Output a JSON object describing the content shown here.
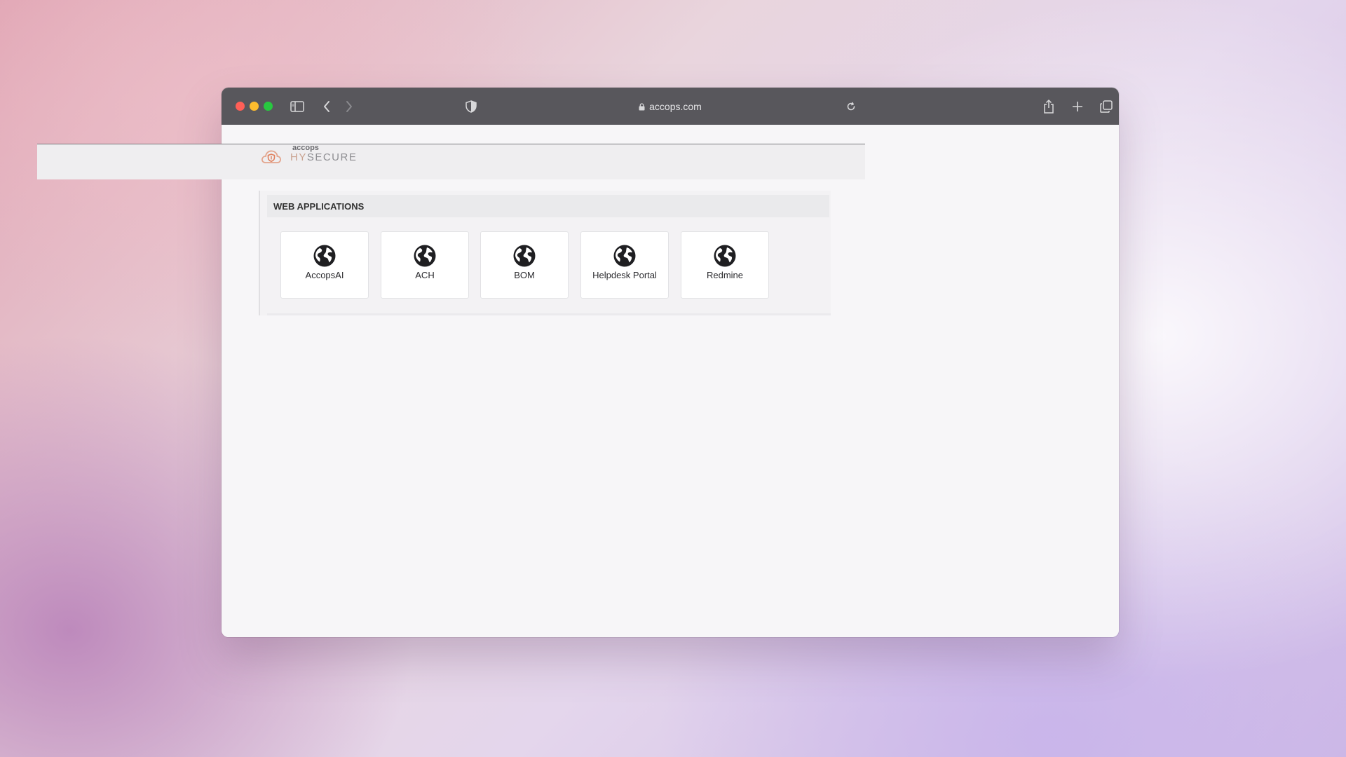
{
  "browser": {
    "url": "accops.com",
    "icons": [
      "sidebar-icon",
      "back-icon",
      "forward-icon",
      "shield-icon",
      "lock-icon",
      "reload-icon",
      "share-icon",
      "new-tab-icon",
      "tabs-overview-icon"
    ]
  },
  "logo": {
    "small": "accops",
    "big_prefix": "HY",
    "big_suffix": "SECURE"
  },
  "web_apps": {
    "title": "WEB APPLICATIONS",
    "items": [
      {
        "label": "AccopsAI",
        "icon": "globe-icon"
      },
      {
        "label": "ACH",
        "icon": "globe-icon"
      },
      {
        "label": "BOM",
        "icon": "globe-icon"
      },
      {
        "label": "Helpdesk Portal",
        "icon": "globe-icon"
      },
      {
        "label": "Redmine",
        "icon": "globe-icon"
      }
    ]
  },
  "colors": {
    "titlebar": "#58575c",
    "traffic_red": "#ff5f57",
    "traffic_yellow": "#febc2e",
    "traffic_green": "#28c840",
    "logo_accent": "#e0805e"
  }
}
